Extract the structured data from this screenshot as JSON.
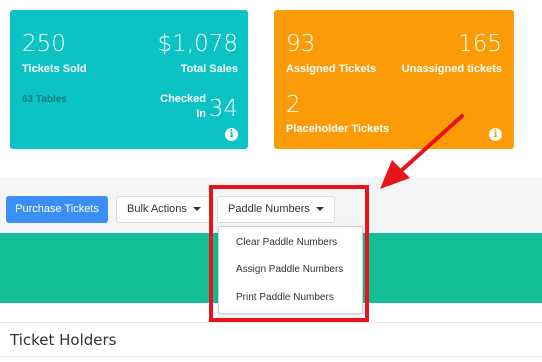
{
  "colors": {
    "teal_card": "#0bc2c4",
    "orange_card": "#fb9b08",
    "primary_button": "#3b8ef4",
    "green_band": "#14bf95",
    "highlight_red": "#e8141b"
  },
  "stats_card_1": {
    "tickets_sold_value": "250",
    "tickets_sold_label": "Tickets Sold",
    "total_sales_value": "$1,078",
    "total_sales_label": "Total Sales",
    "tables_text": "63 Tables",
    "checked_in_label_line1": "Checked",
    "checked_in_label_line2": "In",
    "checked_in_value": "34",
    "info_icon": "i"
  },
  "stats_card_2": {
    "assigned_value": "93",
    "assigned_label": "Assigned Tickets",
    "unassigned_value": "165",
    "unassigned_label": "Unassigned tickets",
    "placeholder_value": "2",
    "placeholder_label": "Placeholder Tickets",
    "info_icon": "i"
  },
  "toolbar": {
    "purchase_label": "Purchase Tickets",
    "bulk_actions_label": "Bulk Actions",
    "paddle_numbers_label": "Paddle Numbers"
  },
  "paddle_menu": {
    "items": [
      "Clear Paddle Numbers",
      "Assign Paddle Numbers",
      "Print Paddle Numbers"
    ]
  },
  "section": {
    "title": "Ticket Holders"
  }
}
